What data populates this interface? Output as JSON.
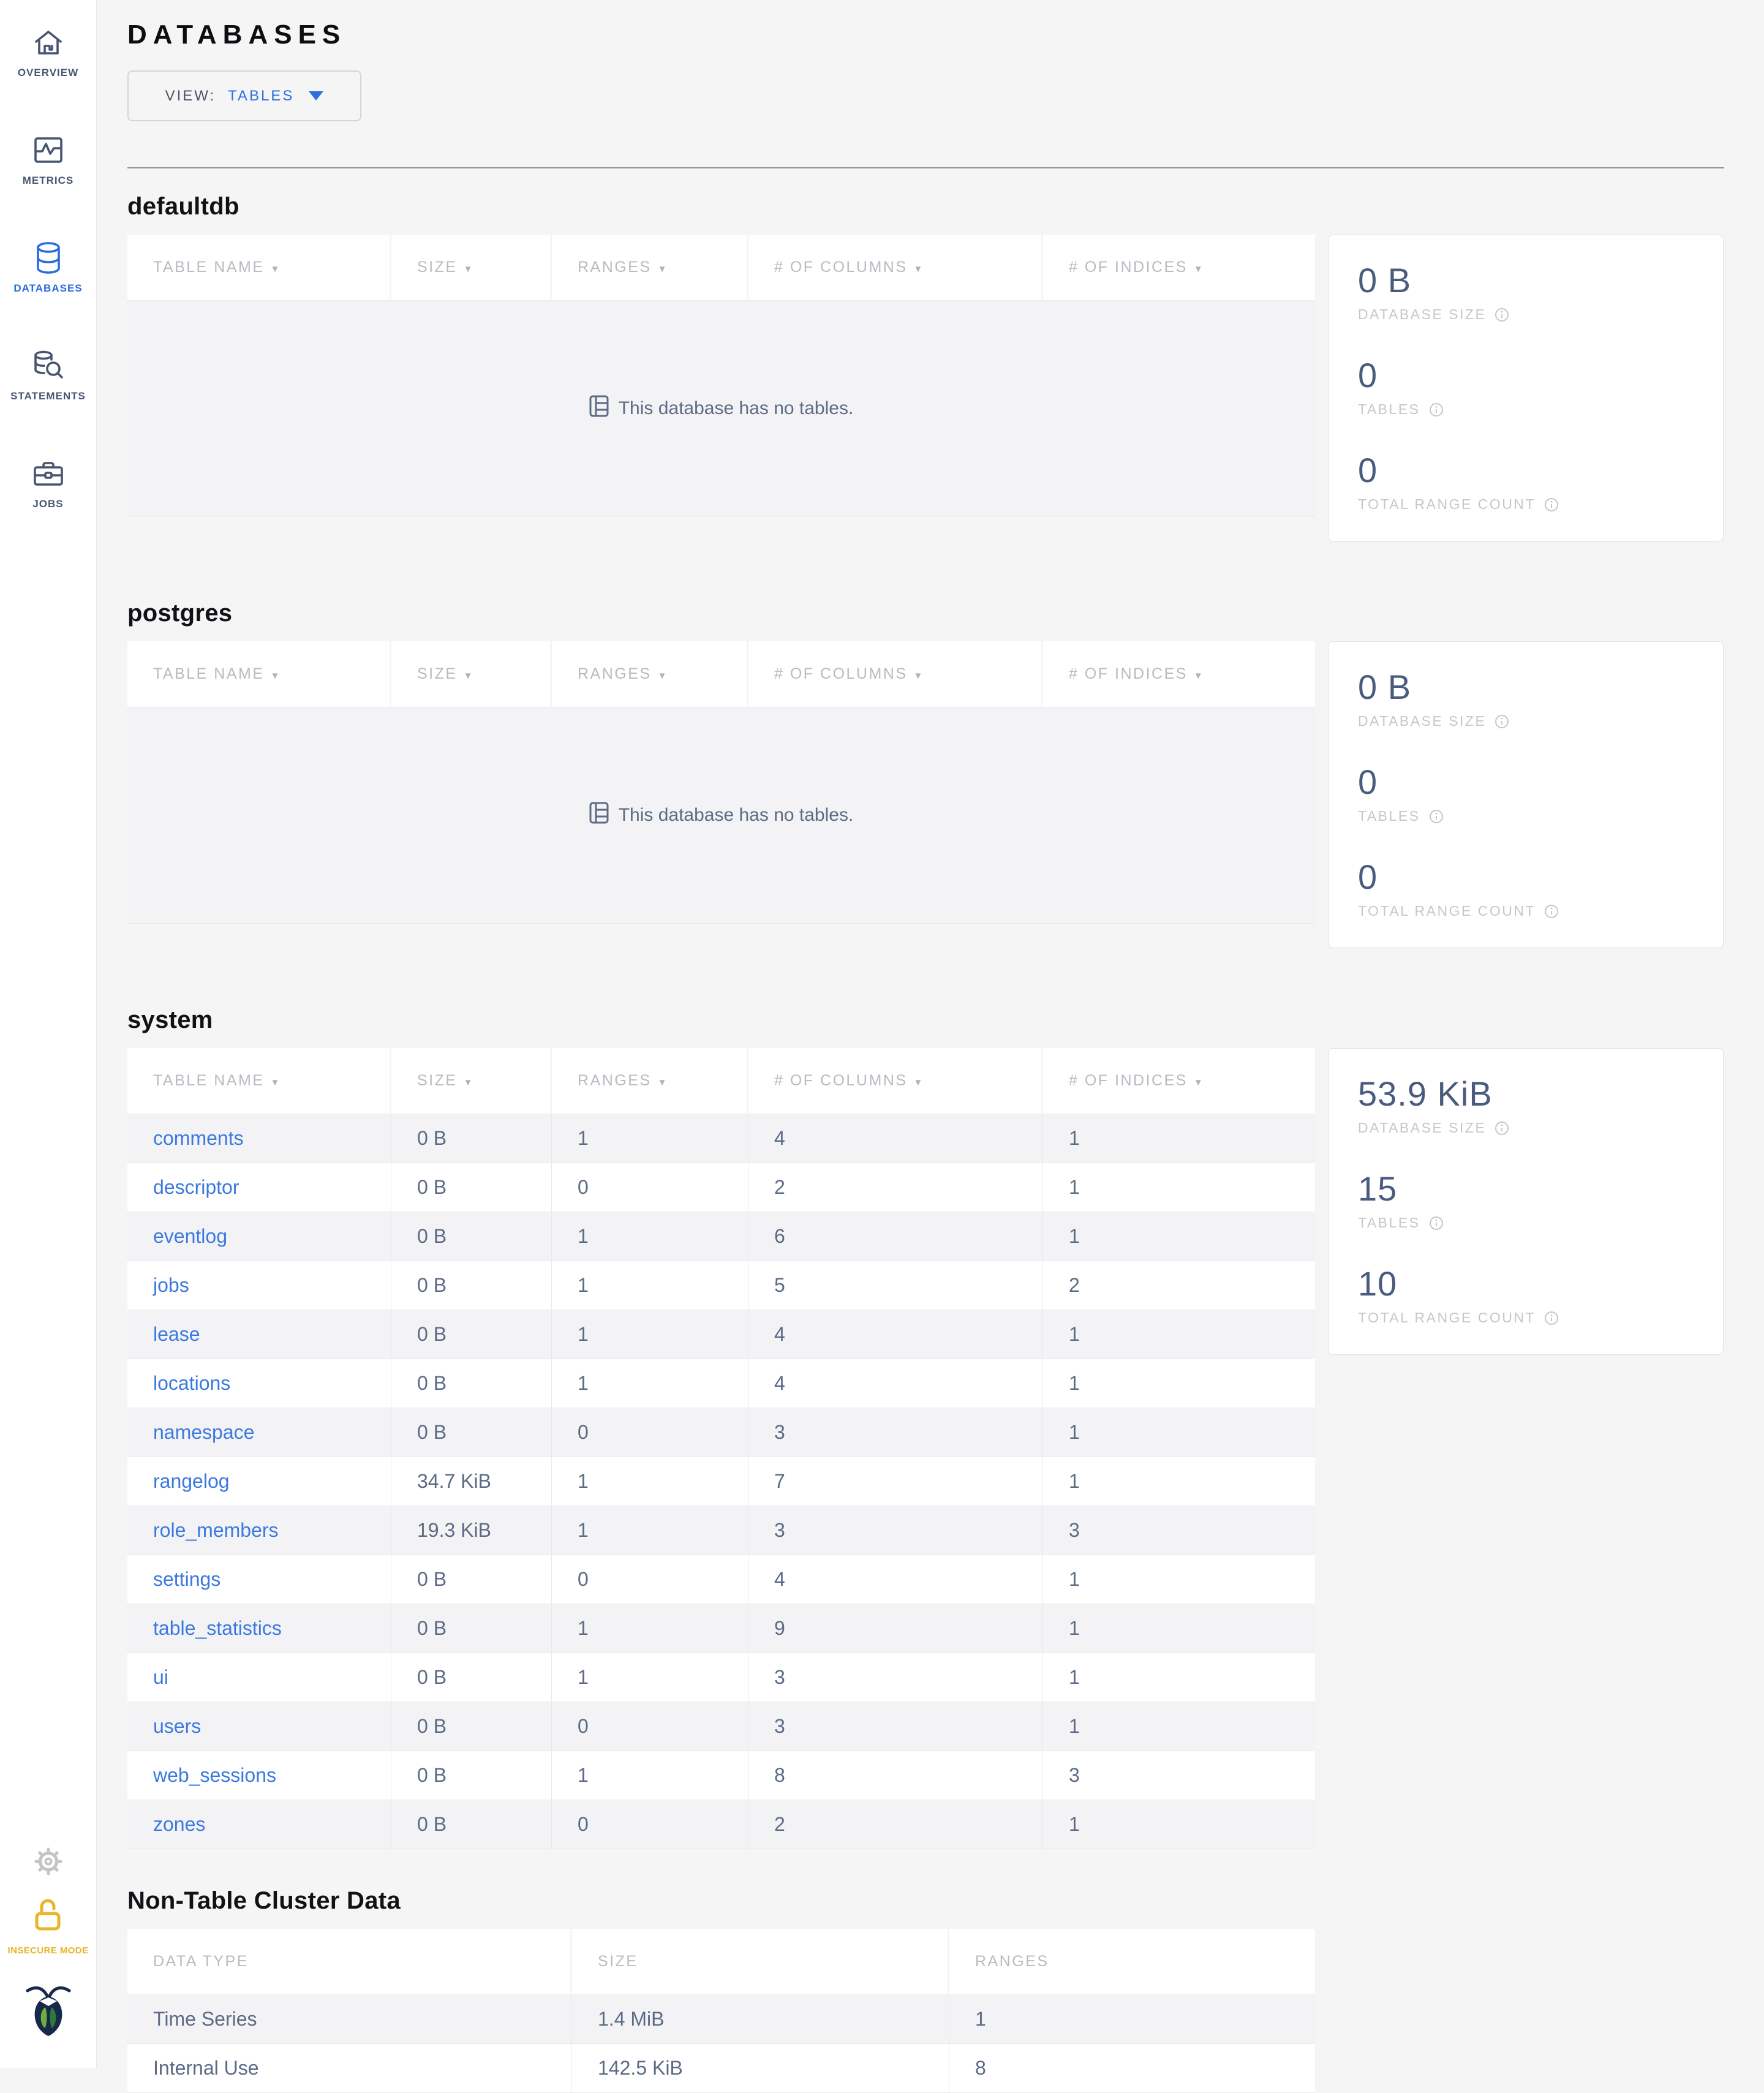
{
  "sidebar": {
    "items": [
      {
        "id": "overview",
        "label": "OVERVIEW",
        "icon": "home-icon",
        "active": false
      },
      {
        "id": "metrics",
        "label": "METRICS",
        "icon": "metrics-chart-icon",
        "active": false
      },
      {
        "id": "databases",
        "label": "DATABASES",
        "icon": "database-cylinder-icon",
        "active": true
      },
      {
        "id": "statements",
        "label": "STATEMENTS",
        "icon": "database-search-icon",
        "active": false
      },
      {
        "id": "jobs",
        "label": "JOBS",
        "icon": "briefcase-icon",
        "active": false
      }
    ],
    "insecure_label": "INSECURE MODE"
  },
  "header": {
    "title": "DATABASES",
    "view_label": "VIEW:",
    "view_value": "TABLES"
  },
  "table_columns": [
    "TABLE NAME",
    "SIZE",
    "RANGES",
    "# OF COLUMNS",
    "# OF INDICES"
  ],
  "empty_message": "This database has no tables.",
  "stats_labels": {
    "size": "DATABASE SIZE",
    "tables": "TABLES",
    "ranges": "TOTAL RANGE COUNT"
  },
  "databases": [
    {
      "name": "defaultdb",
      "empty": true,
      "stats": {
        "size": "0 B",
        "tables": "0",
        "range_count": "0"
      }
    },
    {
      "name": "postgres",
      "empty": true,
      "stats": {
        "size": "0 B",
        "tables": "0",
        "range_count": "0"
      }
    },
    {
      "name": "system",
      "empty": false,
      "rows": [
        [
          "comments",
          "0 B",
          "1",
          "4",
          "1"
        ],
        [
          "descriptor",
          "0 B",
          "0",
          "2",
          "1"
        ],
        [
          "eventlog",
          "0 B",
          "1",
          "6",
          "1"
        ],
        [
          "jobs",
          "0 B",
          "1",
          "5",
          "2"
        ],
        [
          "lease",
          "0 B",
          "1",
          "4",
          "1"
        ],
        [
          "locations",
          "0 B",
          "1",
          "4",
          "1"
        ],
        [
          "namespace",
          "0 B",
          "0",
          "3",
          "1"
        ],
        [
          "rangelog",
          "34.7 KiB",
          "1",
          "7",
          "1"
        ],
        [
          "role_members",
          "19.3 KiB",
          "1",
          "3",
          "3"
        ],
        [
          "settings",
          "0 B",
          "0",
          "4",
          "1"
        ],
        [
          "table_statistics",
          "0 B",
          "1",
          "9",
          "1"
        ],
        [
          "ui",
          "0 B",
          "1",
          "3",
          "1"
        ],
        [
          "users",
          "0 B",
          "0",
          "3",
          "1"
        ],
        [
          "web_sessions",
          "0 B",
          "1",
          "8",
          "3"
        ],
        [
          "zones",
          "0 B",
          "0",
          "2",
          "1"
        ]
      ],
      "stats": {
        "size": "53.9 KiB",
        "tables": "15",
        "range_count": "10"
      }
    }
  ],
  "non_table": {
    "title": "Non-Table Cluster Data",
    "columns": [
      "DATA TYPE",
      "SIZE",
      "RANGES"
    ],
    "rows": [
      [
        "Time Series",
        "1.4 MiB",
        "1"
      ],
      [
        "Internal Use",
        "142.5 KiB",
        "8"
      ]
    ]
  },
  "colors": {
    "accent_blue": "#2b6be2",
    "link_blue": "#3b79df",
    "slate_text": "#5c6a84",
    "stat_value": "#4a5c7e",
    "muted_label": "#c4c7cc",
    "header_gray": "#b8bbc1",
    "insecure_yellow": "#eab427",
    "page_bg": "#f5f5f6",
    "row_alt_bg": "#f3f3f5",
    "logo_navy": "#17294a",
    "leaf_green_light": "#6fae3c",
    "leaf_green_dark": "#2f7a38"
  }
}
